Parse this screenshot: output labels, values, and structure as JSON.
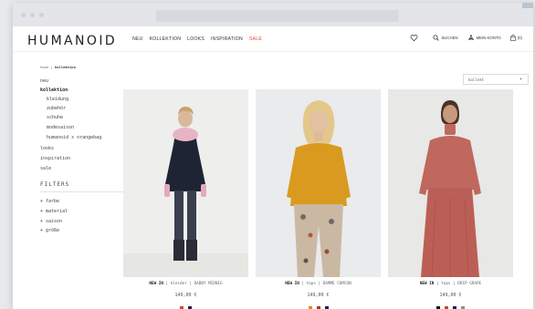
{
  "header": {
    "logo": "HUMANOID",
    "nav": [
      "NEU",
      "KOLLEKTION",
      "LOOKS",
      "INSPIRATION",
      "SALE"
    ],
    "search_label": "SUCHEN",
    "account_label": "MEIN KONTO",
    "cart_label": "(0)"
  },
  "breadcrumb": {
    "home": "home",
    "separator": " | ",
    "current": "kollektion"
  },
  "sidebar": {
    "neu": "neu",
    "kollektion": "kollektion",
    "sub": [
      "kleidung",
      "zubehör",
      "schuhe",
      "modesaison",
      "humanoid x orangebag"
    ],
    "looks": "looks",
    "inspiration": "inspiration",
    "sale": "sale",
    "filters_title": "FILTERS",
    "filters": [
      "+ farbe",
      "+ material",
      "+ saison",
      "+ größe"
    ]
  },
  "sort": {
    "value": "kollekt"
  },
  "products": [
    {
      "badge": "NEW IN",
      "category": "kleider",
      "name": "DABBY MIDNIG",
      "price": "149,00 €",
      "swatches": [
        "#d04a3c",
        "#18204a"
      ]
    },
    {
      "badge": "NEW IN",
      "category": "tops",
      "name": "DAMME CUMCON",
      "price": "149,00 €",
      "swatches": [
        "#e08a2a",
        "#b8322a",
        "#1c2450"
      ]
    },
    {
      "badge": "NEW IN",
      "category": "tops",
      "name": "DRIP GRAPE",
      "price": "149,00 €",
      "swatches": [
        "#111111",
        "#c04a3c",
        "#1c2450",
        "#9a8c80"
      ]
    }
  ],
  "colors": {
    "sale": "#e0473a",
    "photo_bg_1": "#eeeeec",
    "photo_bg_2": "#e9ebec",
    "photo_bg_3": "#e8e8e6"
  }
}
